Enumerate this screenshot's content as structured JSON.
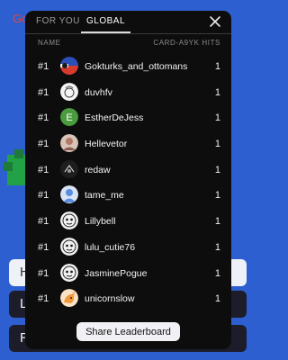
{
  "background": {
    "top_text": "Go",
    "buttons": [
      "H",
      "L",
      "R"
    ]
  },
  "tabs": [
    {
      "label": "FOR YOU"
    },
    {
      "label": "GLOBAL"
    }
  ],
  "header": {
    "name_label": "NAME",
    "hits_label": "CARD-A9YK HITS"
  },
  "rows": [
    {
      "rank": "#1",
      "name": "Gokturks_and_ottomans",
      "hits": "1",
      "avatar": "flag-avatar"
    },
    {
      "rank": "#1",
      "name": "duvhfv",
      "hits": "1",
      "avatar": "sketch-face-avatar"
    },
    {
      "rank": "#1",
      "name": "EstherDeJess",
      "hits": "1",
      "avatar": "letter-avatar",
      "letter": "E"
    },
    {
      "rank": "#1",
      "name": "Hellevetor",
      "hits": "1",
      "avatar": "photo-avatar"
    },
    {
      "rank": "#1",
      "name": "redaw",
      "hits": "1",
      "avatar": "dark-avatar"
    },
    {
      "rank": "#1",
      "name": "tame_me",
      "hits": "1",
      "avatar": "default-user-avatar"
    },
    {
      "rank": "#1",
      "name": "Lillybell",
      "hits": "1",
      "avatar": "face-avatar"
    },
    {
      "rank": "#1",
      "name": "lulu_cutie76",
      "hits": "1",
      "avatar": "face-avatar"
    },
    {
      "rank": "#1",
      "name": "JasminePogue",
      "hits": "1",
      "avatar": "face-avatar"
    },
    {
      "rank": "#1",
      "name": "unicornslow",
      "hits": "1",
      "avatar": "unicorn-avatar"
    }
  ],
  "share_label": "Share Leaderboard",
  "colors": {
    "modal_bg": "#0d0d0d",
    "page_bg": "#2d5fd0",
    "letter_avatar": "#4a9b3e"
  }
}
